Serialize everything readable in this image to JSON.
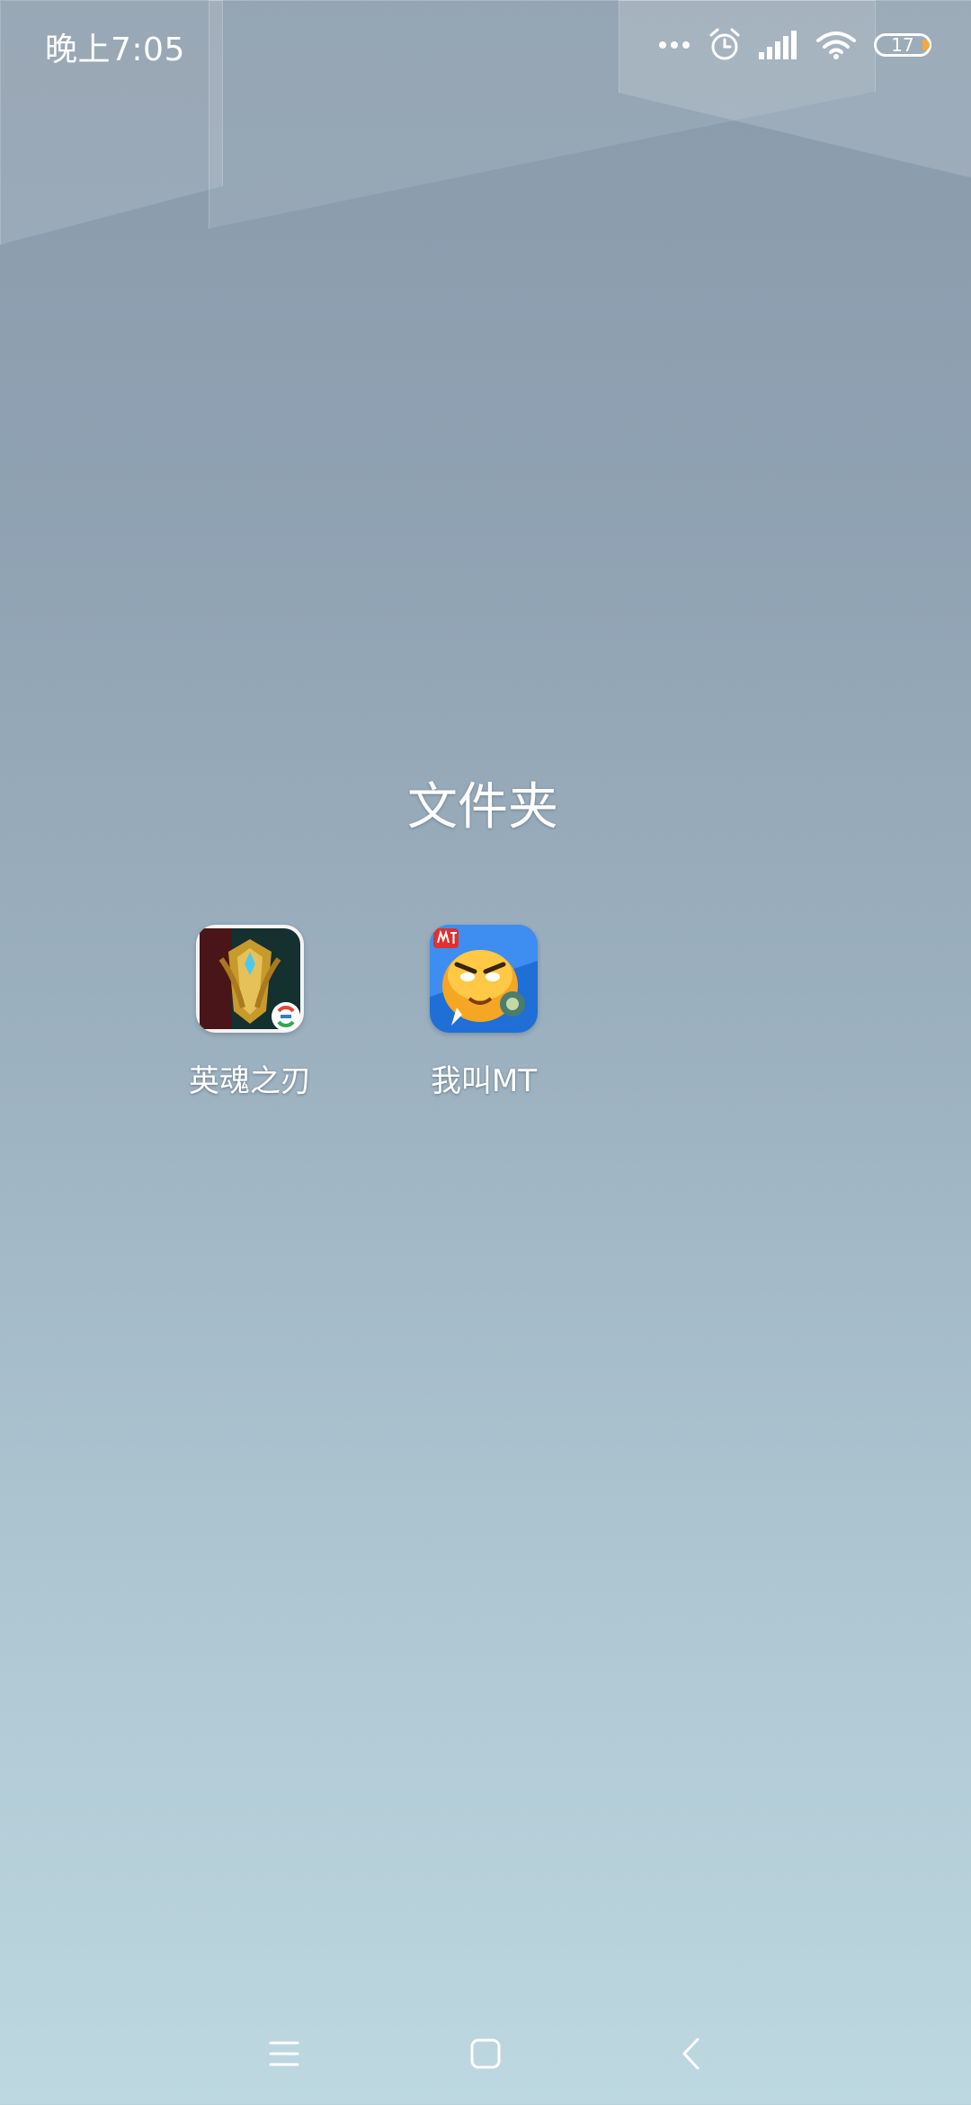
{
  "status_bar": {
    "time": "晚上7:05",
    "battery_level": "17",
    "icons": [
      "more-dots-icon",
      "alarm-icon",
      "signal-icon",
      "wifi-icon",
      "battery-icon"
    ]
  },
  "folder": {
    "title": "文件夹",
    "apps": [
      {
        "label": "英魂之刃",
        "icon": "yinghun-zhiren-app-icon"
      },
      {
        "label": "我叫MT",
        "icon": "wo-jiao-mt-app-icon"
      }
    ]
  },
  "nav_bar": {
    "icons": [
      "menu-icon",
      "home-icon",
      "back-icon"
    ]
  },
  "colors": {
    "background_top": "#8a9bab",
    "background_bottom": "#bdd8e0",
    "battery_accent": "#f2a93b"
  }
}
